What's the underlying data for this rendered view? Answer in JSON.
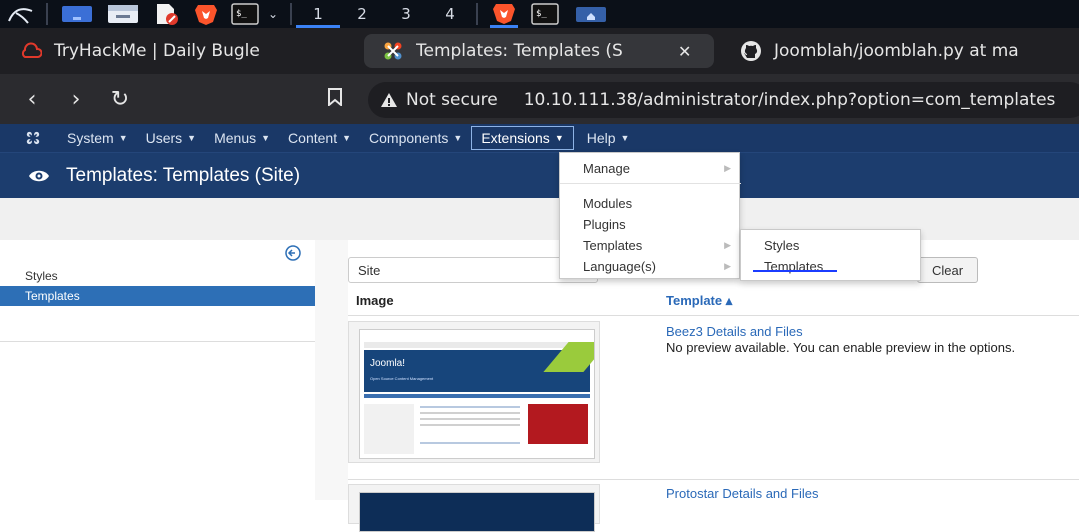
{
  "taskbar": {
    "workspaces": [
      "1",
      "2",
      "3",
      "4"
    ],
    "active_workspace": "1",
    "accent": "#3b82f6"
  },
  "browser": {
    "tabs": [
      {
        "title": "TryHackMe | Daily Bugle",
        "icon": "tryhackme-icon"
      },
      {
        "title": "Templates: Templates (S",
        "icon": "joomla-icon",
        "active": true
      },
      {
        "title": "Joomblah/joomblah.py at ma",
        "icon": "github-icon"
      }
    ],
    "security_label": "Not secure",
    "url": "10.10.111.38/administrator/index.php?option=com_templates"
  },
  "joomla": {
    "menubar": [
      "System",
      "Users",
      "Menus",
      "Content",
      "Components",
      "Extensions",
      "Help"
    ],
    "open_menu": "Extensions",
    "page_title": "Templates: Templates (Site)",
    "brand_color": "#1a3867",
    "dropdown": {
      "manage": "Manage",
      "modules": "Modules",
      "plugins": "Plugins",
      "templates": "Templates",
      "languages": "Language(s)"
    },
    "submenu": {
      "styles": "Styles",
      "templates": "Templates"
    }
  },
  "sidebar": {
    "items": [
      {
        "label": "Styles"
      },
      {
        "label": "Templates",
        "active": true
      }
    ]
  },
  "main": {
    "filter_value": "Site",
    "clear_label": "Clear",
    "columns": {
      "image": "Image",
      "template": "Template ▴"
    },
    "rows": [
      {
        "title": "Beez3 Details and Files",
        "desc": "No preview available. You can enable preview in the options.",
        "thumb_brand": "Joomla!",
        "thumb_sub": "Open Source Content Management"
      },
      {
        "title": "Protostar Details and Files"
      }
    ]
  }
}
